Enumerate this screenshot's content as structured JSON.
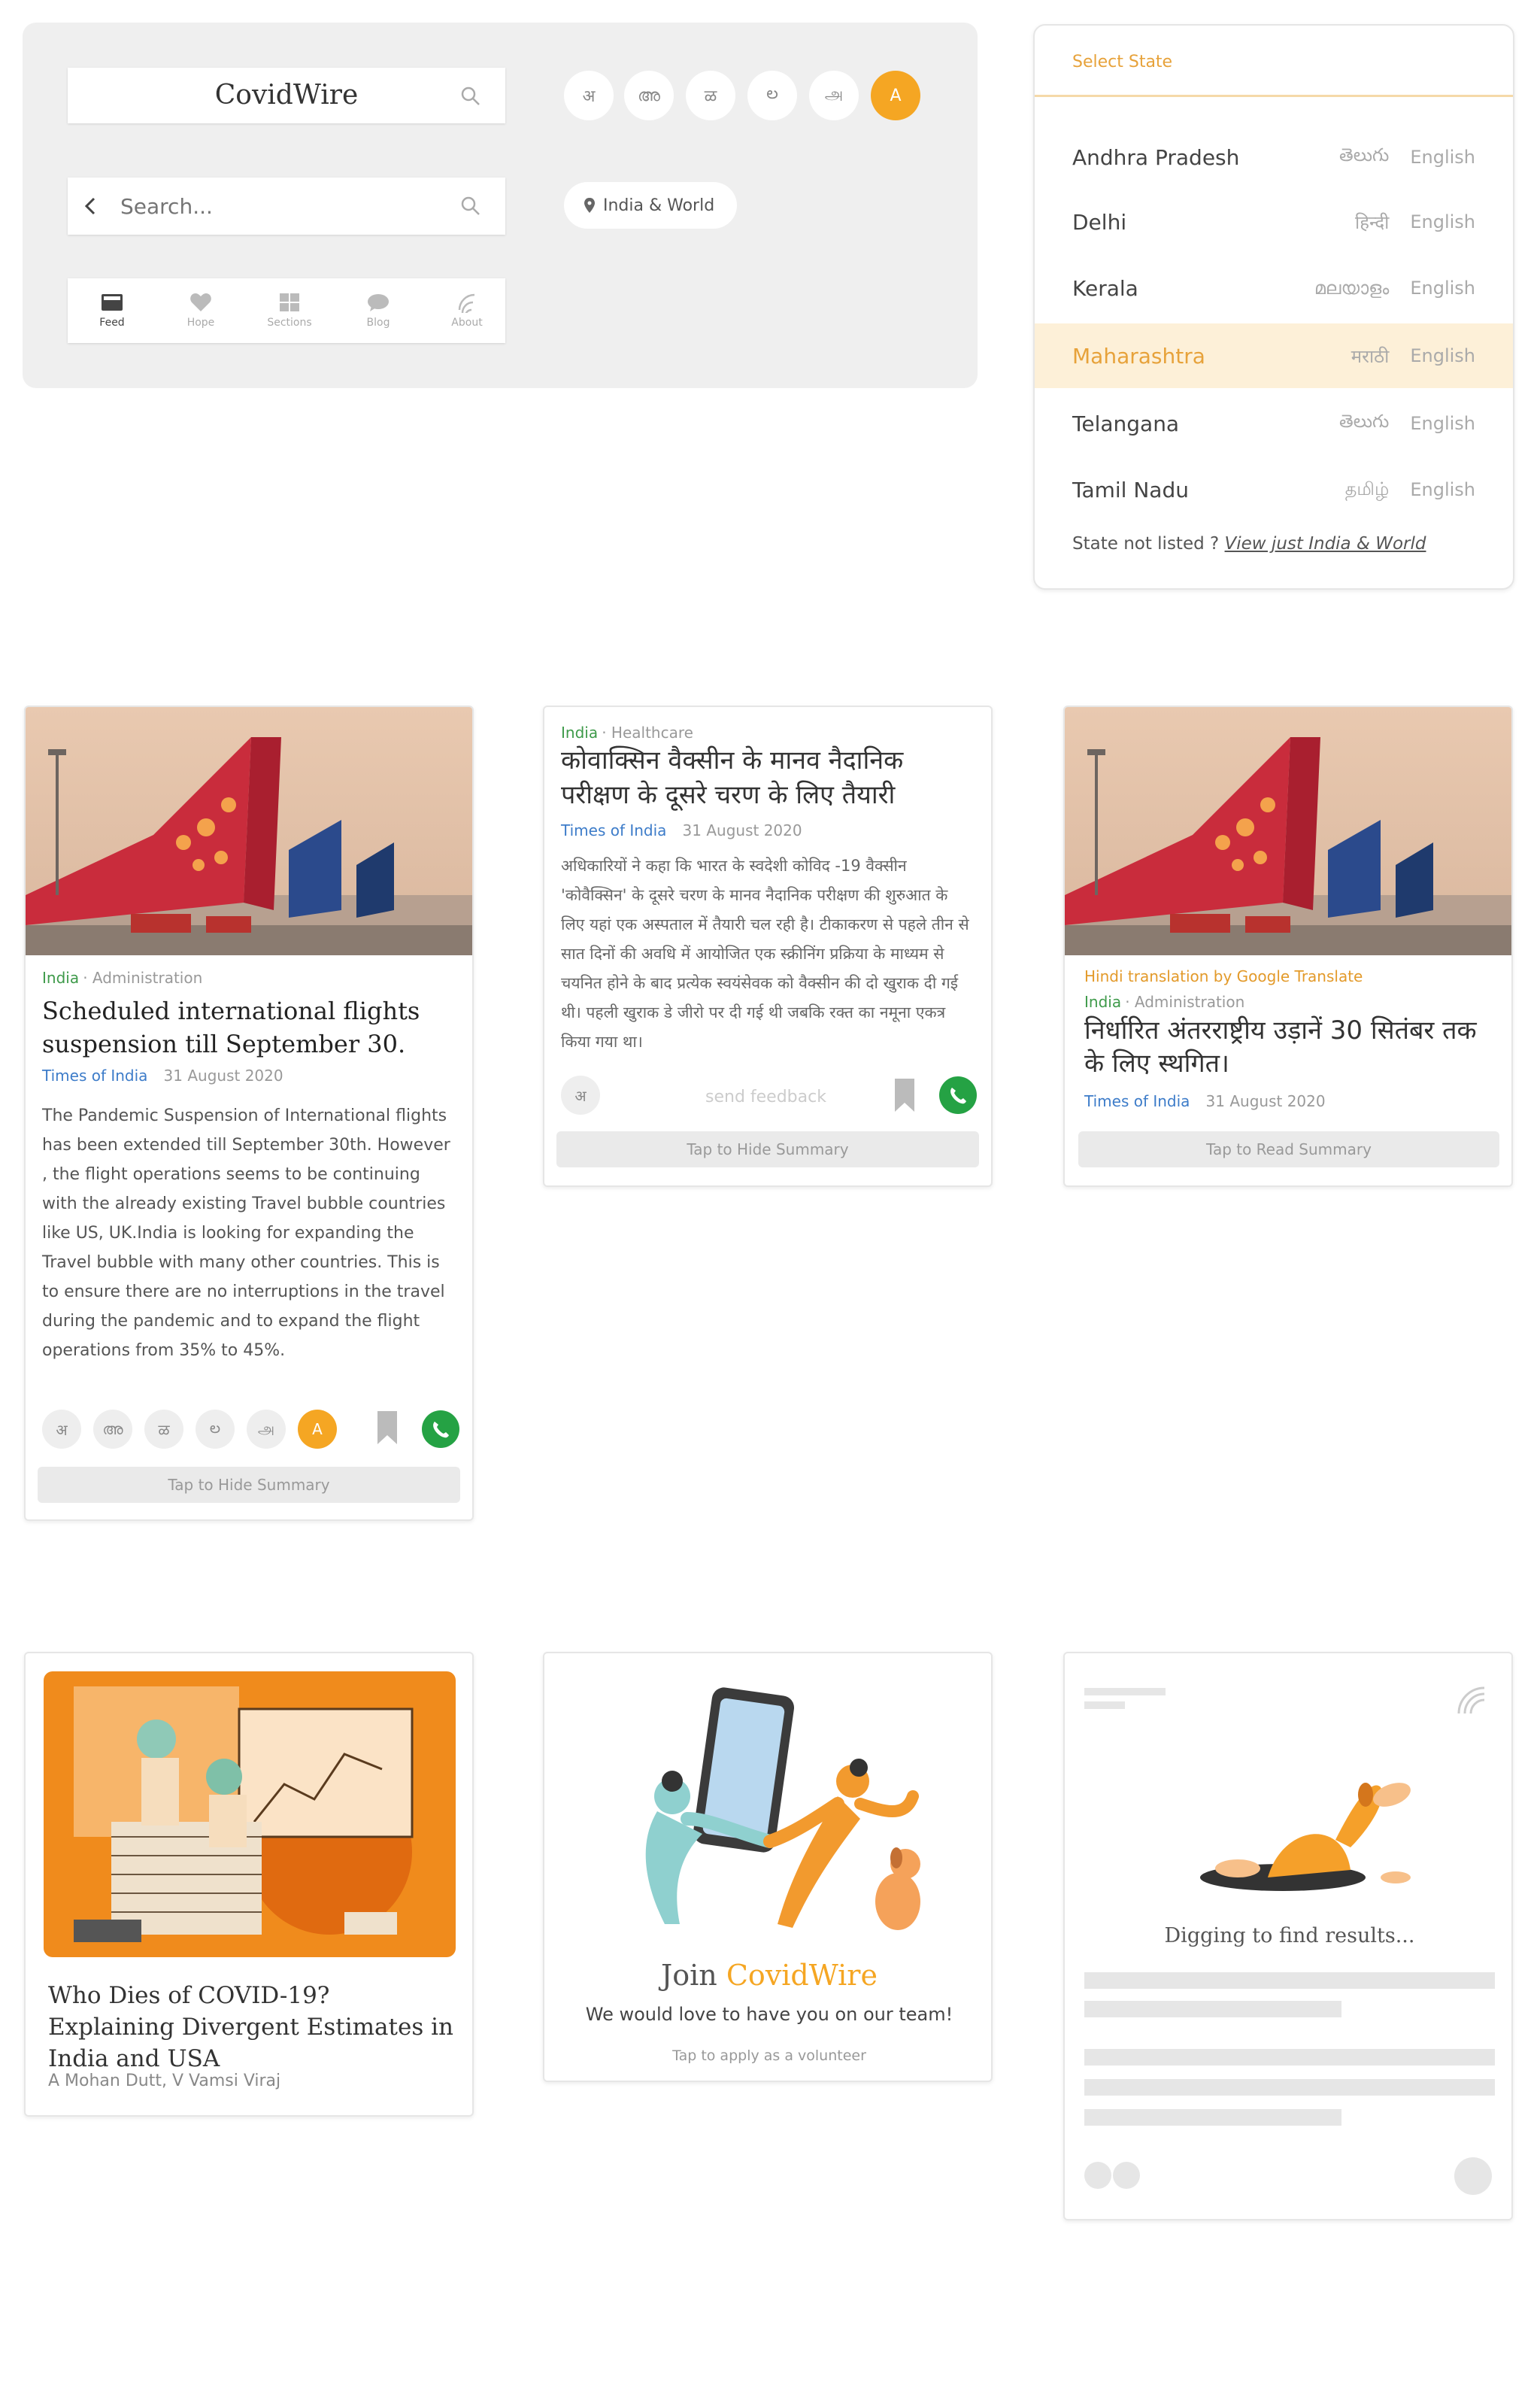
{
  "header": {
    "app_title": "CovidWire",
    "search_placeholder": "Search...",
    "language_buttons": [
      "अ",
      "അ",
      "ळ",
      "ల",
      "அ",
      "A"
    ],
    "location_chip": "India & World",
    "nav_items": [
      "Feed",
      "Hope",
      "Sections",
      "Blog",
      "About"
    ]
  },
  "state_selector": {
    "title": "Select State",
    "states": [
      {
        "name": "Andhra Pradesh",
        "native": "తెలుగు",
        "english": "English"
      },
      {
        "name": "Delhi",
        "native": "हिन्दी",
        "english": "English"
      },
      {
        "name": "Kerala",
        "native": "മലയാളം",
        "english": "English"
      },
      {
        "name": "Maharashtra",
        "native": "मराठी",
        "english": "English"
      },
      {
        "name": "Telangana",
        "native": "తెలుగు",
        "english": "English"
      },
      {
        "name": "Tamil Nadu",
        "native": "தமிழ்",
        "english": "English"
      }
    ],
    "footer_text": "State not listed ? ",
    "footer_link": "View just India & World"
  },
  "card1": {
    "category": "India",
    "subcategory": "Administration",
    "title": "Scheduled international flights suspension till September 30.",
    "source": "Times of India",
    "date": "31 August 2020",
    "summary": "The Pandemic Suspension of International flights has been extended till September 30th. However , the flight operations seems to be continuing with the already existing Travel bubble countries like US, UK.India is looking for expanding the Travel bubble with many other countries. This is to ensure there are no interruptions in the travel during the pandemic and to expand the flight operations from 35% to 45%.",
    "languages": [
      "अ",
      "അ",
      "ळ",
      "ల",
      "அ",
      "A"
    ],
    "button": "Tap to Hide Summary"
  },
  "card2": {
    "category": "India",
    "subcategory": "Healthcare",
    "title": "कोवाक्सिन वैक्सीन के मानव नैदानिक परीक्षण के दूसरे चरण के लिए तैयारी",
    "source": "Times of India",
    "date": "31 August 2020",
    "summary": "अधिकारियों ने कहा कि भारत के स्वदेशी कोविद -19 वैक्सीन 'कोवैक्सिन' के दूसरे चरण के मानव नैदानिक परीक्षण की शुरुआत के लिए यहां एक अस्पताल में तैयारी चल रही है। टीकाकरण से पहले तीन से सात दिनों की अवधि में आयोजित एक स्क्रीनिंग प्रक्रिया के माध्यम से चयनित होने के बाद प्रत्येक स्वयंसेवक को वैक्सीन की दो खुराक दी गई थी। पहली खुराक डे जीरो पर दी गई थी जबकि रक्त का नमूना एकत्र किया गया था।",
    "lang_button": "अ",
    "feedback": "send feedback",
    "button": "Tap to Hide Summary"
  },
  "card3": {
    "translation_note": "Hindi translation by Google Translate",
    "category": "India",
    "subcategory": "Administration",
    "title": "निर्धारित अंतरराष्ट्रीय उड़ानें 30 सितंबर तक के लिए स्थगित।",
    "source": "Times of India",
    "date": "31 August 2020",
    "button": "Tap to Read Summary"
  },
  "card4": {
    "title": "Who Dies of COVID-19? Explaining Divergent Estimates in India and USA",
    "authors": "A Mohan Dutt, V Vamsi Viraj"
  },
  "card5": {
    "join": "Join ",
    "brand": "CovidWire",
    "subtitle": "We would love to have you on our team!",
    "cta": "Tap to apply as a volunteer"
  },
  "card6": {
    "loading_text": "Digging to find results..."
  },
  "colors": {
    "accent": "#f5a623",
    "green": "#3e9a4a",
    "blue": "#3d7cc9",
    "whatsapp": "#25a244"
  }
}
